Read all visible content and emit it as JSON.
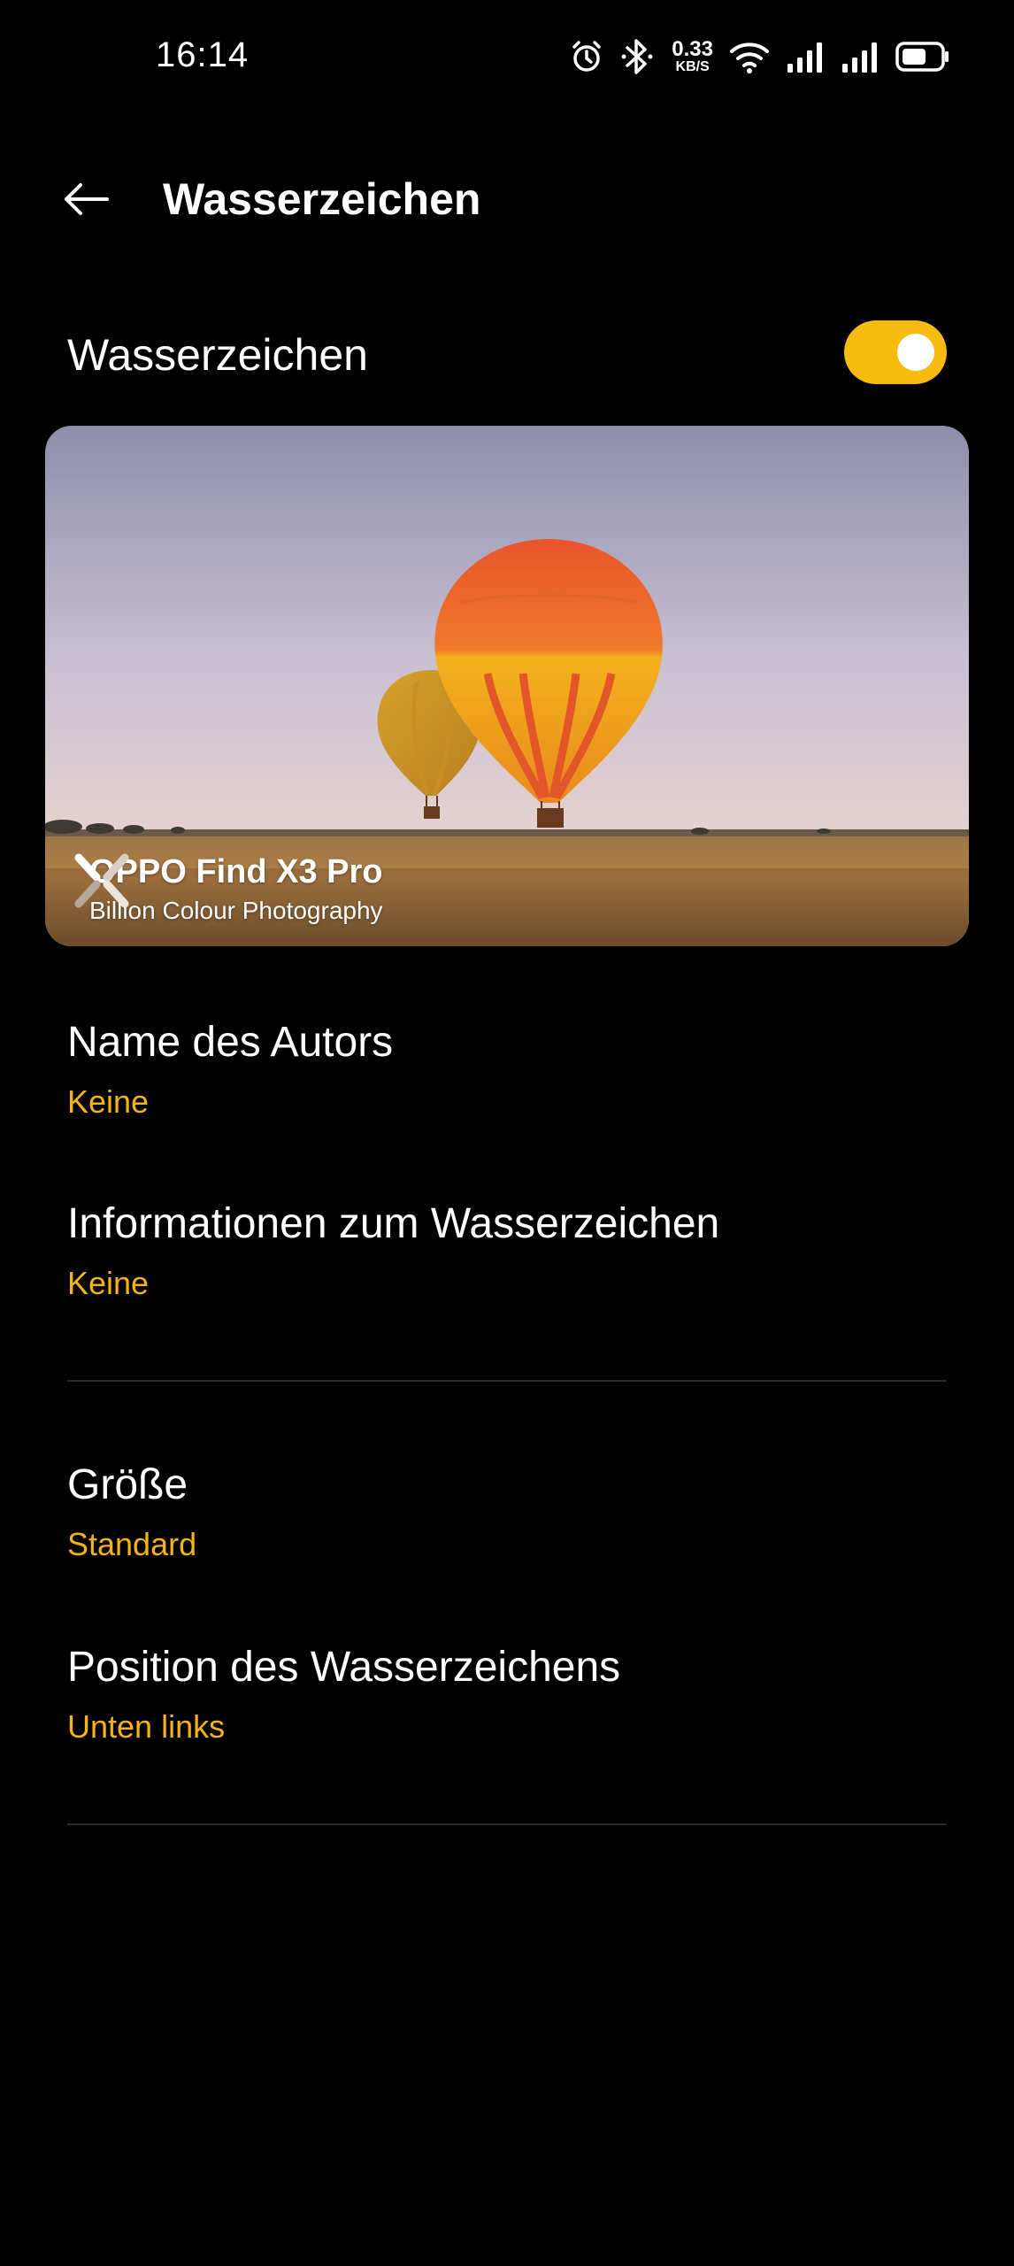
{
  "status_bar": {
    "time": "16:14",
    "net_speed_value": "0.33",
    "net_speed_unit": "KB/S",
    "icons": [
      "alarm-icon",
      "bluetooth-icon",
      "wifi-icon",
      "signal-icon",
      "signal-icon",
      "battery-icon"
    ]
  },
  "header": {
    "back_icon": "arrow-left-icon",
    "title": "Wasserzeichen"
  },
  "watermark_toggle": {
    "label": "Wasserzeichen",
    "enabled": true
  },
  "preview": {
    "watermark_title": "OPPO Find X3 Pro",
    "watermark_subtitle": "Billion Colour Photography"
  },
  "settings": [
    {
      "title": "Name des Autors",
      "value": "Keine"
    },
    {
      "title": "Informationen zum Wasserzeichen",
      "value": "Keine"
    },
    {
      "title": "Größe",
      "value": "Standard"
    },
    {
      "title": "Position des Wasserzeichens",
      "value": "Unten links"
    }
  ],
  "colors": {
    "background": "#000000",
    "accent": "#f6bc10",
    "value_text": "#f3b319"
  }
}
